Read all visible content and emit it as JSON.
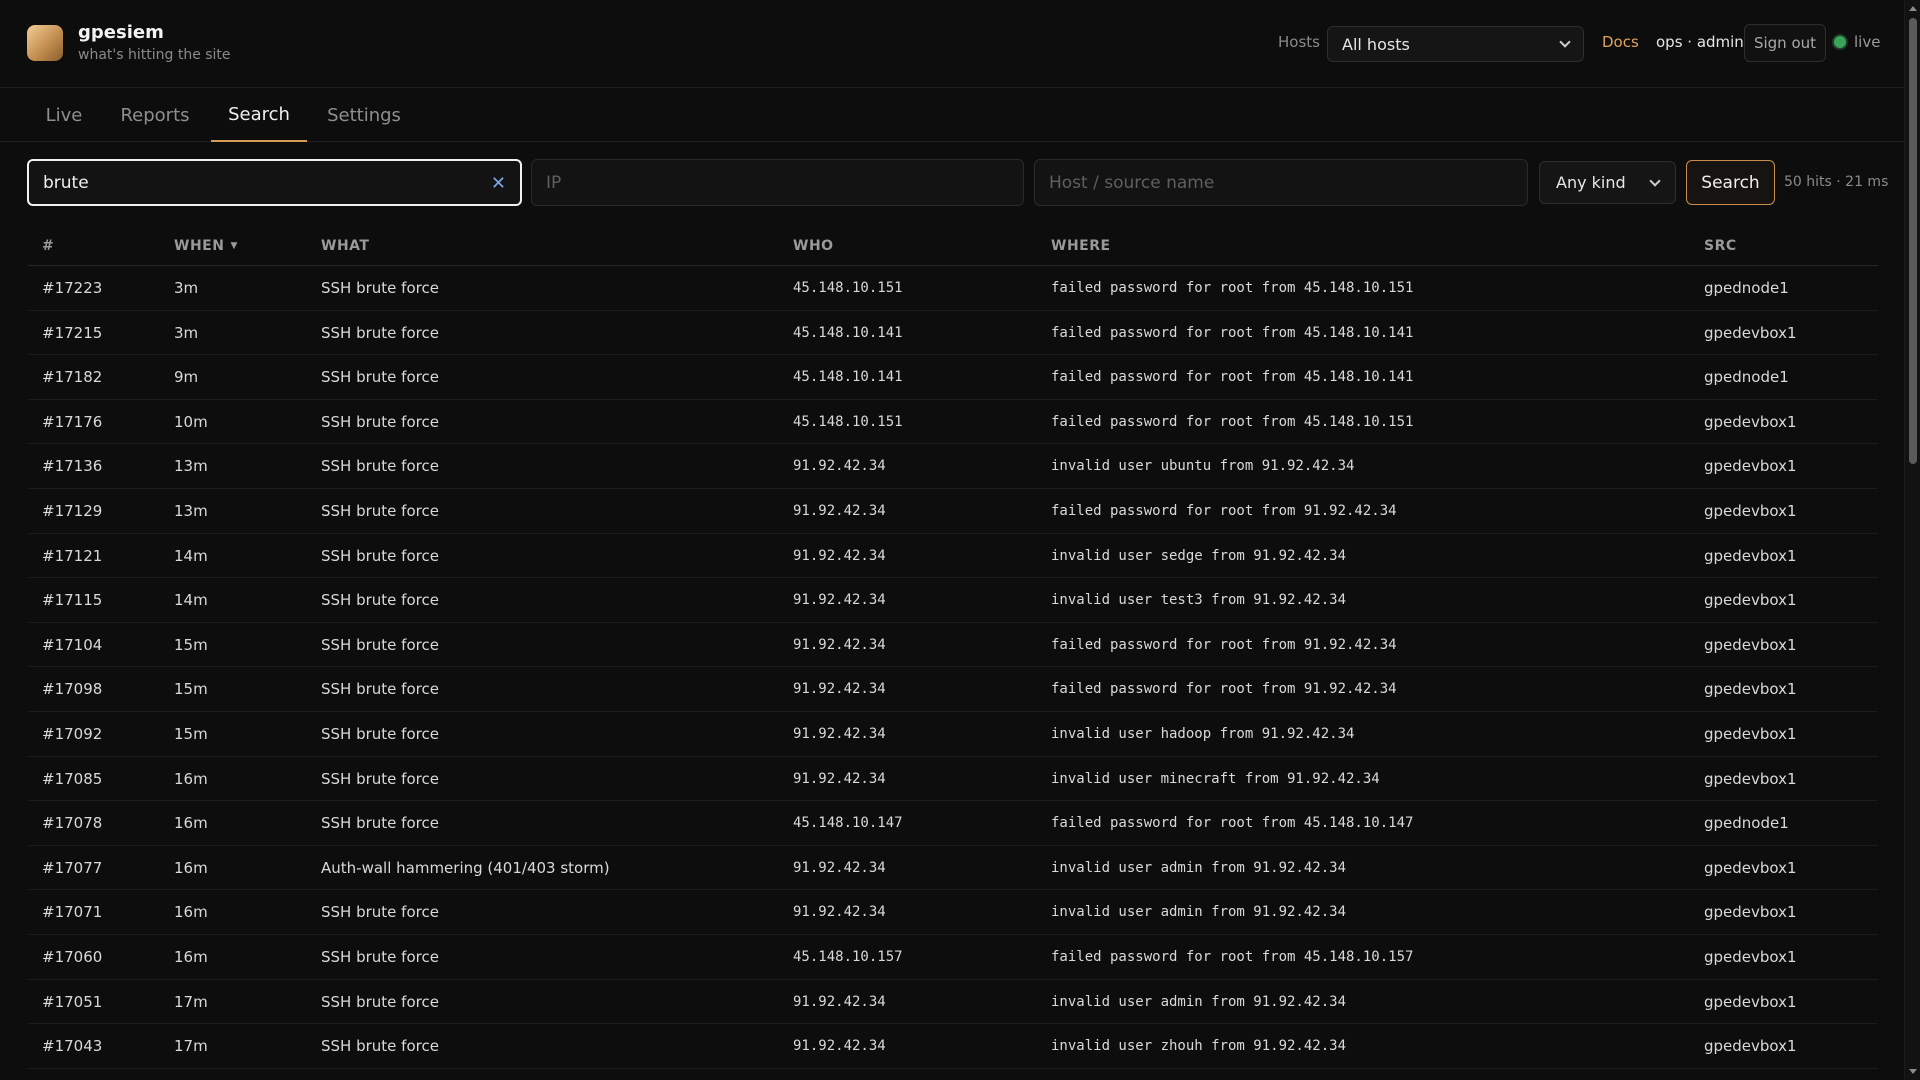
{
  "header": {
    "brand_title": "gpesiem",
    "brand_tagline": "what's hitting the site",
    "hosts_label": "Hosts",
    "hosts_selected": "All hosts",
    "docs_label": "Docs",
    "user_label": "ops · admin",
    "signout_label": "Sign out",
    "live_label": "live",
    "live_color": "#3aa35a",
    "accent_color": "#e0a35a"
  },
  "tabs": [
    {
      "label": "Live",
      "active": false
    },
    {
      "label": "Reports",
      "active": false
    },
    {
      "label": "Search",
      "active": true
    },
    {
      "label": "Settings",
      "active": false
    }
  ],
  "filters": {
    "query_value": "brute",
    "ip_placeholder": "IP",
    "ip_value": "",
    "host_placeholder": "Host / source name",
    "host_value": "",
    "kind_selected": "Any kind",
    "search_label": "Search",
    "hits_summary": "50 hits · 21 ms"
  },
  "table": {
    "columns": [
      "#",
      "WHEN",
      "WHAT",
      "WHO",
      "WHERE",
      "SRC"
    ],
    "sort_column": "WHEN",
    "rows": [
      {
        "id": "#17223",
        "when": "3m",
        "what": "SSH brute force",
        "who": "45.148.10.151",
        "where": "failed password for root from 45.148.10.151",
        "src": "gpednode1"
      },
      {
        "id": "#17215",
        "when": "3m",
        "what": "SSH brute force",
        "who": "45.148.10.141",
        "where": "failed password for root from 45.148.10.141",
        "src": "gpedevbox1"
      },
      {
        "id": "#17182",
        "when": "9m",
        "what": "SSH brute force",
        "who": "45.148.10.141",
        "where": "failed password for root from 45.148.10.141",
        "src": "gpednode1"
      },
      {
        "id": "#17176",
        "when": "10m",
        "what": "SSH brute force",
        "who": "45.148.10.151",
        "where": "failed password for root from 45.148.10.151",
        "src": "gpedevbox1"
      },
      {
        "id": "#17136",
        "when": "13m",
        "what": "SSH brute force",
        "who": "91.92.42.34",
        "where": "invalid user ubuntu from 91.92.42.34",
        "src": "gpedevbox1"
      },
      {
        "id": "#17129",
        "when": "13m",
        "what": "SSH brute force",
        "who": "91.92.42.34",
        "where": "failed password for root from 91.92.42.34",
        "src": "gpedevbox1"
      },
      {
        "id": "#17121",
        "when": "14m",
        "what": "SSH brute force",
        "who": "91.92.42.34",
        "where": "invalid user sedge from 91.92.42.34",
        "src": "gpedevbox1"
      },
      {
        "id": "#17115",
        "when": "14m",
        "what": "SSH brute force",
        "who": "91.92.42.34",
        "where": "invalid user test3 from 91.92.42.34",
        "src": "gpedevbox1"
      },
      {
        "id": "#17104",
        "when": "15m",
        "what": "SSH brute force",
        "who": "91.92.42.34",
        "where": "failed password for root from 91.92.42.34",
        "src": "gpedevbox1"
      },
      {
        "id": "#17098",
        "when": "15m",
        "what": "SSH brute force",
        "who": "91.92.42.34",
        "where": "failed password for root from 91.92.42.34",
        "src": "gpedevbox1"
      },
      {
        "id": "#17092",
        "when": "15m",
        "what": "SSH brute force",
        "who": "91.92.42.34",
        "where": "invalid user hadoop from 91.92.42.34",
        "src": "gpedevbox1"
      },
      {
        "id": "#17085",
        "when": "16m",
        "what": "SSH brute force",
        "who": "91.92.42.34",
        "where": "invalid user minecraft from 91.92.42.34",
        "src": "gpedevbox1"
      },
      {
        "id": "#17078",
        "when": "16m",
        "what": "SSH brute force",
        "who": "45.148.10.147",
        "where": "failed password for root from 45.148.10.147",
        "src": "gpednode1"
      },
      {
        "id": "#17077",
        "when": "16m",
        "what": "Auth-wall hammering (401/403 storm)",
        "who": "91.92.42.34",
        "where": "invalid user admin from 91.92.42.34",
        "src": "gpedevbox1"
      },
      {
        "id": "#17071",
        "when": "16m",
        "what": "SSH brute force",
        "who": "91.92.42.34",
        "where": "invalid user admin from 91.92.42.34",
        "src": "gpedevbox1"
      },
      {
        "id": "#17060",
        "when": "16m",
        "what": "SSH brute force",
        "who": "45.148.10.157",
        "where": "failed password for root from 45.148.10.157",
        "src": "gpedevbox1"
      },
      {
        "id": "#17051",
        "when": "17m",
        "what": "SSH brute force",
        "who": "91.92.42.34",
        "where": "invalid user admin from 91.92.42.34",
        "src": "gpedevbox1"
      },
      {
        "id": "#17043",
        "when": "17m",
        "what": "SSH brute force",
        "who": "91.92.42.34",
        "where": "invalid user zhouh from 91.92.42.34",
        "src": "gpedevbox1"
      }
    ]
  },
  "icons": {
    "clear": "close-icon",
    "dropdown": "chevron-down-icon",
    "sort": "sort-desc-icon",
    "status": "live-dot-icon"
  }
}
